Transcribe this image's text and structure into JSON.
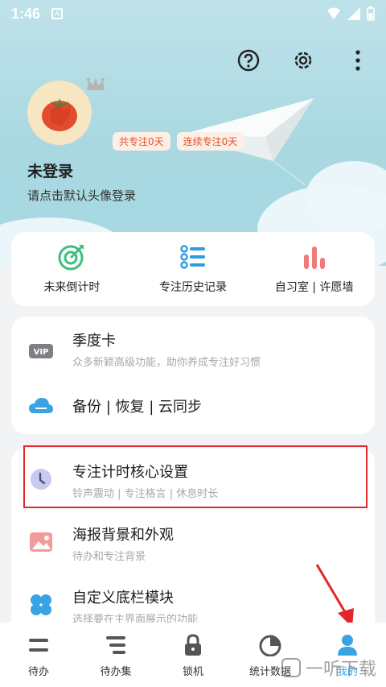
{
  "status_bar": {
    "time": "1:46",
    "app_letter": "A"
  },
  "profile": {
    "title": "未登录",
    "subtitle": "请点击默认头像登录",
    "badge_total": "共专注0天",
    "badge_streak": "连续专注0天"
  },
  "quick_actions": [
    {
      "label": "未来倒计时",
      "icon": "target-icon"
    },
    {
      "label": "专注历史记录",
      "icon": "history-list-icon"
    },
    {
      "label": "自习室 | 许愿墙",
      "icon": "bars-icon"
    }
  ],
  "menu_group1": [
    {
      "title": "季度卡",
      "subtitle": "众多新颖高级功能，助你养成专注好习惯",
      "icon": "vip-icon"
    },
    {
      "title": "备份 | 恢复 | 云同步",
      "subtitle": "",
      "icon": "cloud-icon"
    }
  ],
  "menu_group2": [
    {
      "title": "专注计时核心设置",
      "subtitle": "铃声震动 | 专注格言 | 休息时长",
      "icon": "clock-icon"
    },
    {
      "title": "海报背景和外观",
      "subtitle": "待办和专注背景",
      "icon": "image-icon"
    },
    {
      "title": "自定义底栏模块",
      "subtitle": "选择要在主界面展示的功能",
      "icon": "clover-icon"
    }
  ],
  "tabs": [
    {
      "label": "待办",
      "icon": "todo-icon"
    },
    {
      "label": "待办集",
      "icon": "todo-set-icon"
    },
    {
      "label": "锁机",
      "icon": "lock-icon"
    },
    {
      "label": "统计数据",
      "icon": "pie-chart-icon"
    },
    {
      "label": "我的",
      "icon": "user-icon"
    }
  ],
  "colors": {
    "accent": "#3aa3e3",
    "highlight": "#e3262b",
    "badge_text": "#e0522a"
  },
  "watermark": "一听下载"
}
